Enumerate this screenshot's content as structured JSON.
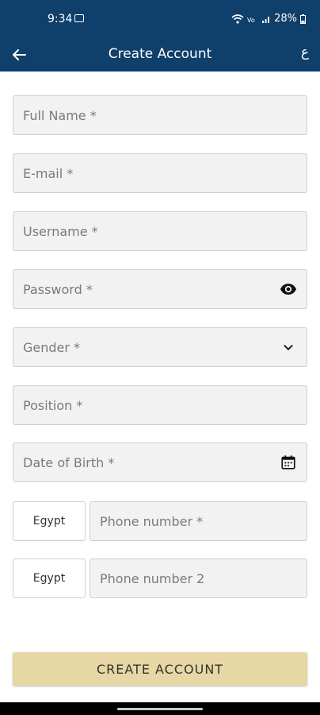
{
  "status_bar": {
    "time": "9:34",
    "battery": "28%"
  },
  "app_bar": {
    "title": "Create Account",
    "language_toggle": "ع"
  },
  "form": {
    "full_name_placeholder": "Full Name *",
    "email_placeholder": "E-mail *",
    "username_placeholder": "Username *",
    "password_placeholder": "Password *",
    "gender_placeholder": "Gender *",
    "position_placeholder": "Position *",
    "dob_placeholder": "Date of Birth *",
    "phone1": {
      "country": "Egypt",
      "placeholder": "Phone number *"
    },
    "phone2": {
      "country": "Egypt",
      "placeholder": "Phone number 2"
    }
  },
  "actions": {
    "create_account_label": "CREATE ACCOUNT"
  },
  "icons": {
    "back": "arrow-left-icon",
    "password_visibility": "eye-icon",
    "gender_dropdown": "chevron-down-icon",
    "date_picker": "calendar-icon"
  },
  "colors": {
    "primary": "#0f3f6b",
    "button": "#e6d7a4",
    "field_bg": "#f2f2f2"
  }
}
